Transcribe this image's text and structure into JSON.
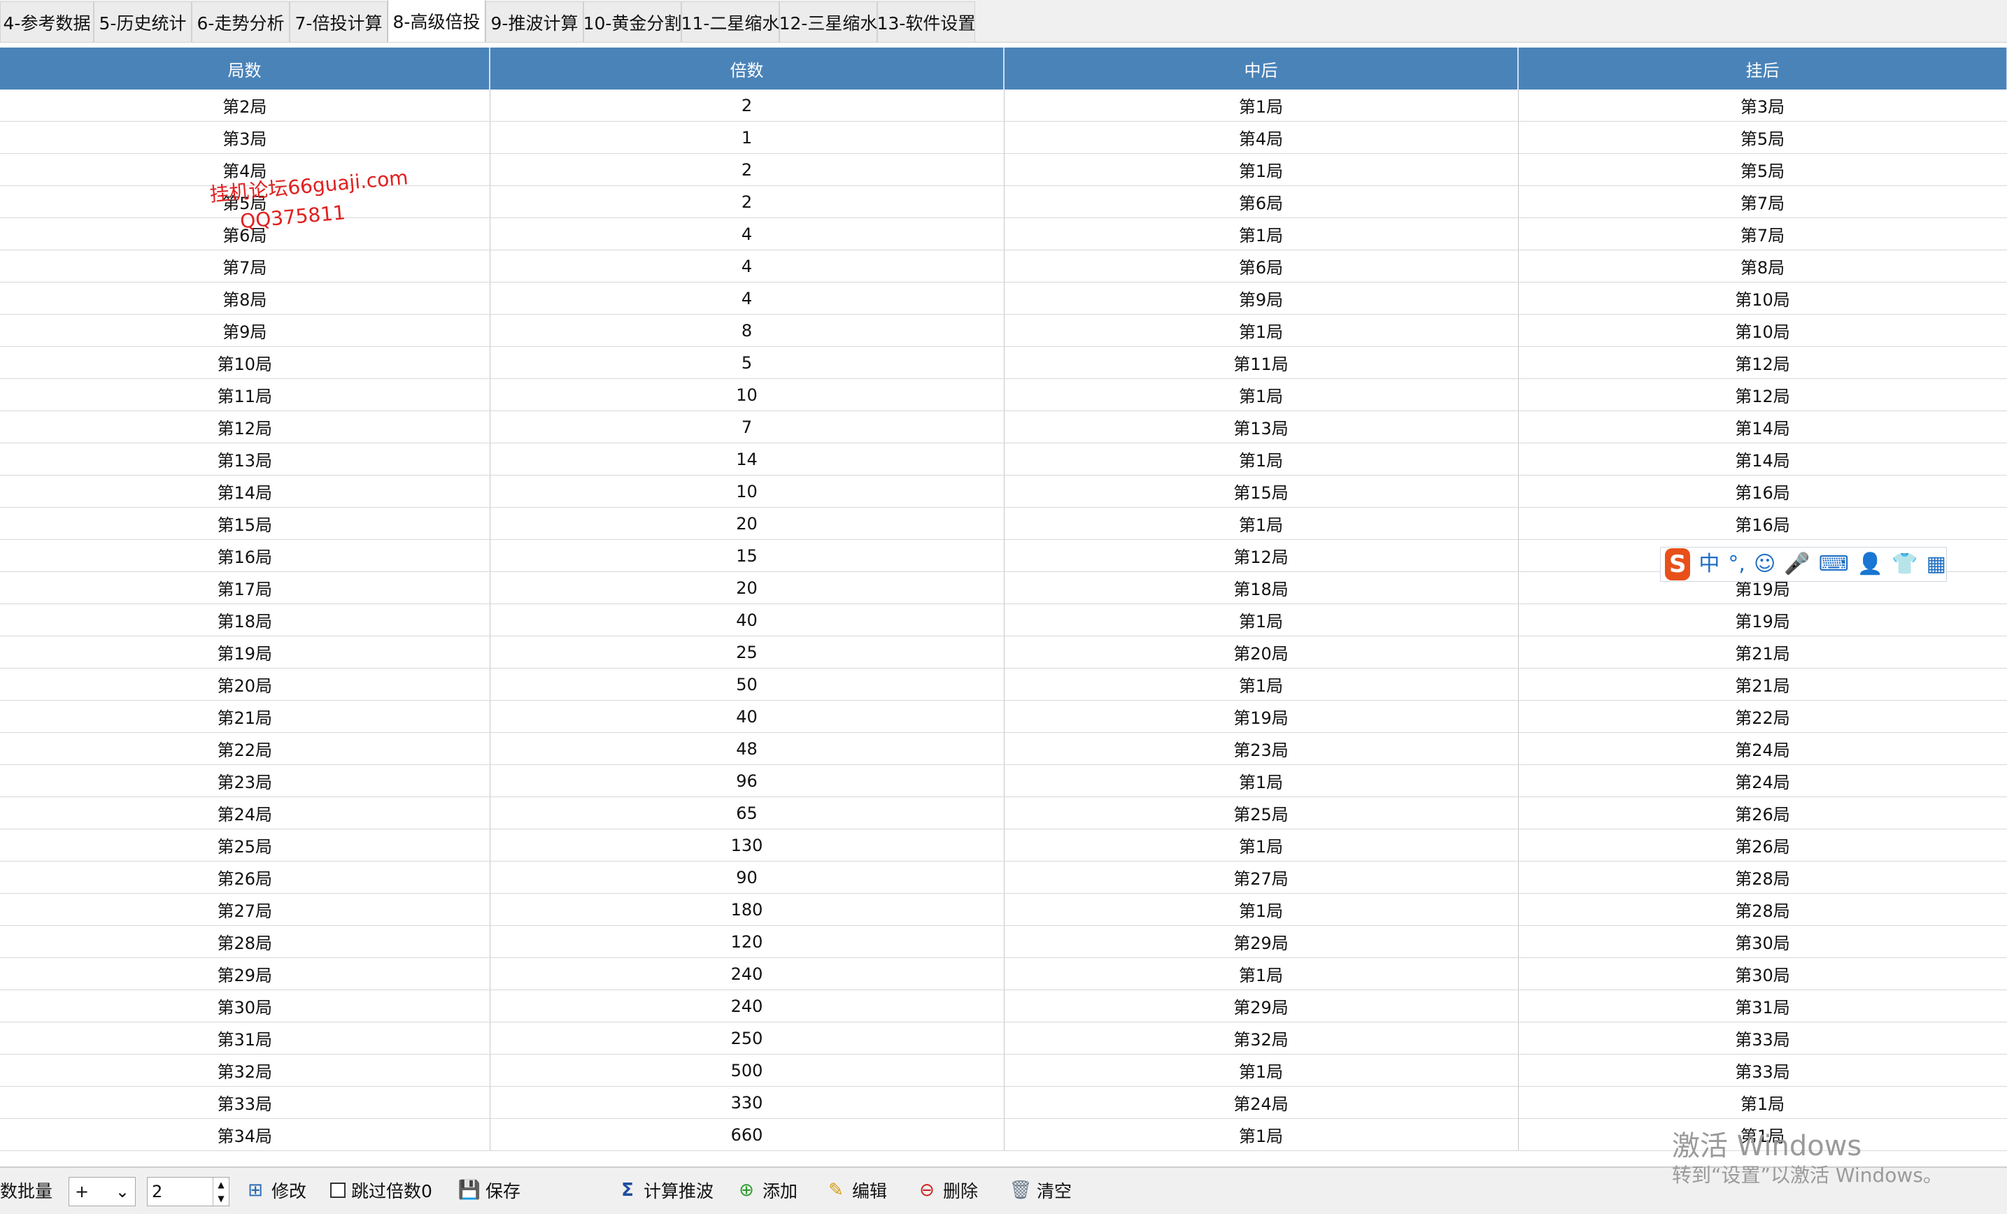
{
  "tabs": [
    {
      "label": "4-参考数据",
      "width": 134
    },
    {
      "label": "5-历史统计",
      "width": 140
    },
    {
      "label": "6-走势分析",
      "width": 140
    },
    {
      "label": "7-倍投计算",
      "width": 140
    },
    {
      "label": "8-高级倍投",
      "width": 140,
      "active": true
    },
    {
      "label": "9-推波计算",
      "width": 140
    },
    {
      "label": "10-黄金分割",
      "width": 140
    },
    {
      "label": "11-二星缩水",
      "width": 140
    },
    {
      "label": "12-三星缩水",
      "width": 140
    },
    {
      "label": "13-软件设置",
      "width": 140
    }
  ],
  "grid": {
    "headers": [
      "局数",
      "倍数",
      "中后",
      "挂后"
    ],
    "rows": [
      [
        "第2局",
        "2",
        "第1局",
        "第3局"
      ],
      [
        "第3局",
        "1",
        "第4局",
        "第5局"
      ],
      [
        "第4局",
        "2",
        "第1局",
        "第5局"
      ],
      [
        "第5局",
        "2",
        "第6局",
        "第7局"
      ],
      [
        "第6局",
        "4",
        "第1局",
        "第7局"
      ],
      [
        "第7局",
        "4",
        "第6局",
        "第8局"
      ],
      [
        "第8局",
        "4",
        "第9局",
        "第10局"
      ],
      [
        "第9局",
        "8",
        "第1局",
        "第10局"
      ],
      [
        "第10局",
        "5",
        "第11局",
        "第12局"
      ],
      [
        "第11局",
        "10",
        "第1局",
        "第12局"
      ],
      [
        "第12局",
        "7",
        "第13局",
        "第14局"
      ],
      [
        "第13局",
        "14",
        "第1局",
        "第14局"
      ],
      [
        "第14局",
        "10",
        "第15局",
        "第16局"
      ],
      [
        "第15局",
        "20",
        "第1局",
        "第16局"
      ],
      [
        "第16局",
        "15",
        "第12局",
        ""
      ],
      [
        "第17局",
        "20",
        "第18局",
        "第19局"
      ],
      [
        "第18局",
        "40",
        "第1局",
        "第19局"
      ],
      [
        "第19局",
        "25",
        "第20局",
        "第21局"
      ],
      [
        "第20局",
        "50",
        "第1局",
        "第21局"
      ],
      [
        "第21局",
        "40",
        "第19局",
        "第22局"
      ],
      [
        "第22局",
        "48",
        "第23局",
        "第24局"
      ],
      [
        "第23局",
        "96",
        "第1局",
        "第24局"
      ],
      [
        "第24局",
        "65",
        "第25局",
        "第26局"
      ],
      [
        "第25局",
        "130",
        "第1局",
        "第26局"
      ],
      [
        "第26局",
        "90",
        "第27局",
        "第28局"
      ],
      [
        "第27局",
        "180",
        "第1局",
        "第28局"
      ],
      [
        "第28局",
        "120",
        "第29局",
        "第30局"
      ],
      [
        "第29局",
        "240",
        "第1局",
        "第30局"
      ],
      [
        "第30局",
        "240",
        "第29局",
        "第31局"
      ],
      [
        "第31局",
        "250",
        "第32局",
        "第33局"
      ],
      [
        "第32局",
        "500",
        "第1局",
        "第33局"
      ],
      [
        "第33局",
        "330",
        "第24局",
        "第1局"
      ],
      [
        "第34局",
        "660",
        "第1局",
        "第1局"
      ]
    ]
  },
  "watermark": {
    "line1": "挂机论坛66guaji.com",
    "line2": "QQ375811"
  },
  "ime": {
    "logo": "S",
    "mode": "中",
    "punct": "°,",
    "emoji": "☺",
    "mic": "🎤",
    "keyboard": "⌨",
    "user": "👤",
    "skin": "👕",
    "grid": "▦"
  },
  "toolbar": {
    "batch_label": "数批量",
    "op_value": "+",
    "num_value": "2",
    "modify": "修改",
    "skip_zero": "跳过倍数0",
    "save": "保存",
    "calc": "计算推波",
    "add": "添加",
    "edit": "编辑",
    "delete": "删除",
    "clear": "清空"
  },
  "activation": {
    "line1": "激活 Windows",
    "line2": "转到“设置”以激活 Windows。"
  },
  "colors": {
    "header_blue": "#4a83b8",
    "watermark_red": "#e02020",
    "ime_blue": "#1f6fc4"
  }
}
